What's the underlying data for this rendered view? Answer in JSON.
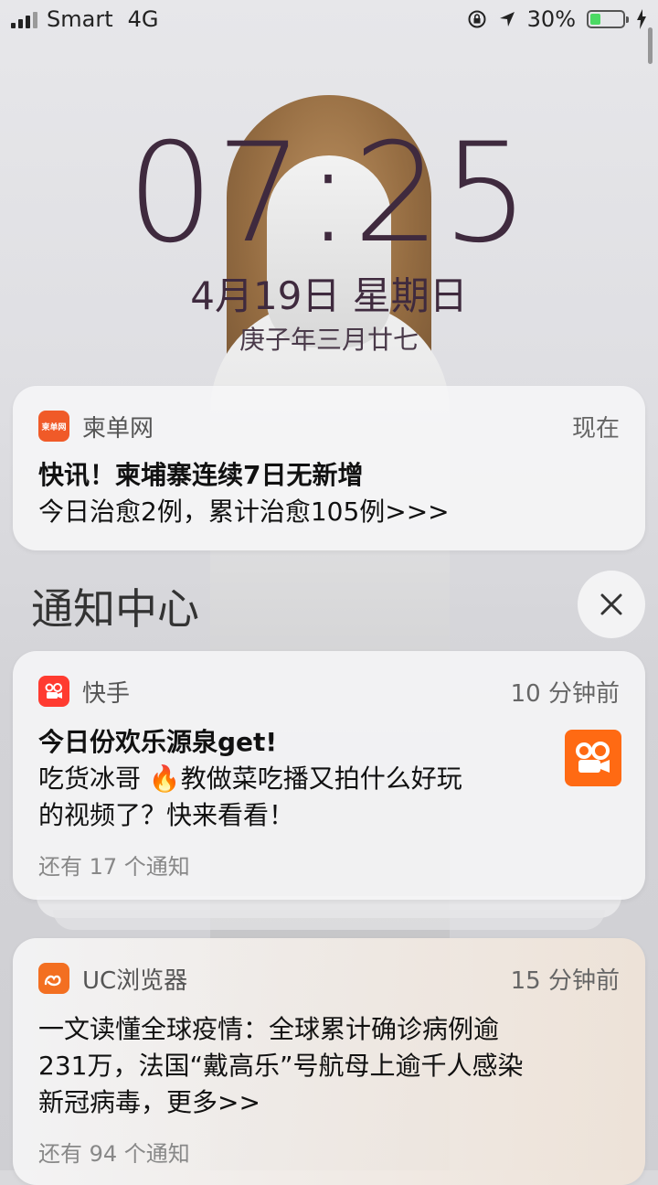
{
  "status_bar": {
    "carrier": "Smart",
    "network": "4G",
    "battery": "30%",
    "battery_level": 0.3,
    "icons": [
      "signal-icon",
      "orientation-lock-icon",
      "location-icon",
      "battery-icon",
      "charging-icon"
    ]
  },
  "lock_screen": {
    "time": "07:25",
    "date": "4月19日 星期日",
    "lunar_date": "庚子年三月廿七"
  },
  "notifications": {
    "pinned": {
      "app": "柬单网",
      "icon_text": "柬单网",
      "time": "现在",
      "title": "快讯！柬埔寨连续7日无新增",
      "body": "今日治愈2例，累计治愈105例>>>"
    },
    "section_title": "通知中心",
    "items": [
      {
        "app": "快手",
        "time": "10 分钟前",
        "title": "今日份欢乐源泉get!",
        "body_line1": "吃货冰哥 🔥教做菜吃播又拍什么好玩",
        "body_line2": "的视频了？快来看看！",
        "more": "还有 17 个通知"
      },
      {
        "app": "UC浏览器",
        "time": "15 分钟前",
        "body_line1": "一文读懂全球疫情：全球累计确诊病例逾",
        "body_line2": "231万，法国“戴高乐”号航母上逾千人感染",
        "body_line3": "新冠病毒，更多>>",
        "more": "还有 94 个通知"
      }
    ]
  },
  "colors": {
    "clock": "#3f2a3e",
    "kuaishou": "#ff5500",
    "jiandan": "#f05a28",
    "uc": "#f36f21"
  }
}
